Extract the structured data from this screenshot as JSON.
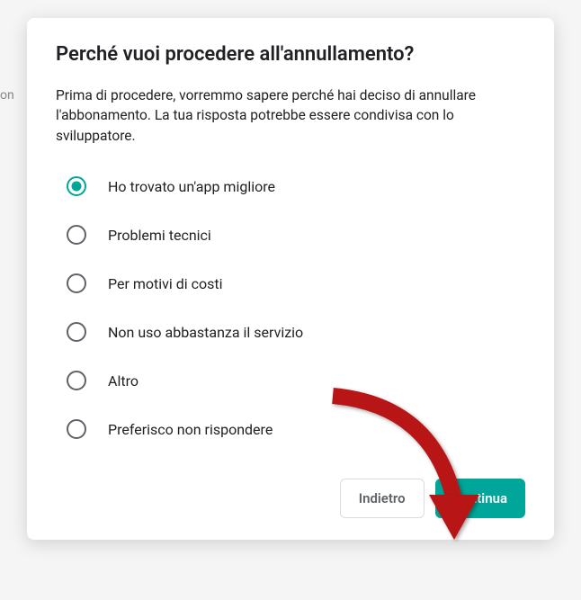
{
  "bg_fragment": "on",
  "modal": {
    "title": "Perché vuoi procedere all'annullamento?",
    "description": "Prima di procedere, vorremmo sapere perché hai deciso di annullare l'abbonamento. La tua risposta potrebbe essere condivisa con lo sviluppatore.",
    "options": [
      {
        "label": "Ho trovato un'app migliore",
        "selected": true
      },
      {
        "label": "Problemi tecnici",
        "selected": false
      },
      {
        "label": "Per motivi di costi",
        "selected": false
      },
      {
        "label": "Non uso abbastanza il servizio",
        "selected": false
      },
      {
        "label": "Altro",
        "selected": false
      },
      {
        "label": "Preferisco non rispondere",
        "selected": false
      }
    ],
    "back_label": "Indietro",
    "continue_label": "Continua"
  },
  "colors": {
    "accent": "#00a699"
  }
}
